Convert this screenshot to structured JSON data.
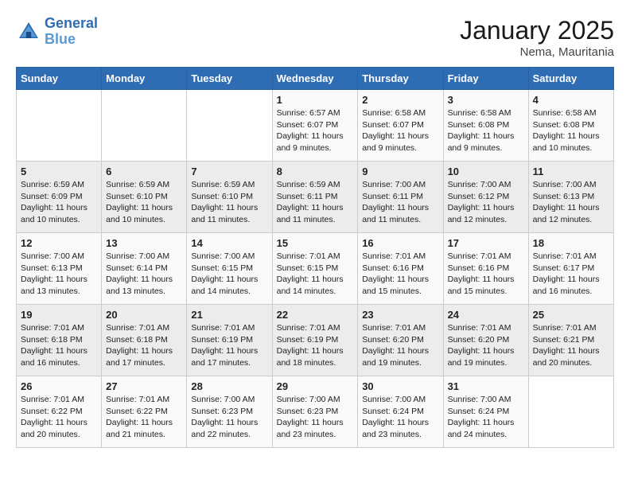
{
  "header": {
    "logo_line1": "General",
    "logo_line2": "Blue",
    "month": "January 2025",
    "location": "Nema, Mauritania"
  },
  "weekdays": [
    "Sunday",
    "Monday",
    "Tuesday",
    "Wednesday",
    "Thursday",
    "Friday",
    "Saturday"
  ],
  "weeks": [
    [
      {
        "day": "",
        "info": ""
      },
      {
        "day": "",
        "info": ""
      },
      {
        "day": "",
        "info": ""
      },
      {
        "day": "1",
        "info": "Sunrise: 6:57 AM\nSunset: 6:07 PM\nDaylight: 11 hours and 9 minutes."
      },
      {
        "day": "2",
        "info": "Sunrise: 6:58 AM\nSunset: 6:07 PM\nDaylight: 11 hours and 9 minutes."
      },
      {
        "day": "3",
        "info": "Sunrise: 6:58 AM\nSunset: 6:08 PM\nDaylight: 11 hours and 9 minutes."
      },
      {
        "day": "4",
        "info": "Sunrise: 6:58 AM\nSunset: 6:08 PM\nDaylight: 11 hours and 10 minutes."
      }
    ],
    [
      {
        "day": "5",
        "info": "Sunrise: 6:59 AM\nSunset: 6:09 PM\nDaylight: 11 hours and 10 minutes."
      },
      {
        "day": "6",
        "info": "Sunrise: 6:59 AM\nSunset: 6:10 PM\nDaylight: 11 hours and 10 minutes."
      },
      {
        "day": "7",
        "info": "Sunrise: 6:59 AM\nSunset: 6:10 PM\nDaylight: 11 hours and 11 minutes."
      },
      {
        "day": "8",
        "info": "Sunrise: 6:59 AM\nSunset: 6:11 PM\nDaylight: 11 hours and 11 minutes."
      },
      {
        "day": "9",
        "info": "Sunrise: 7:00 AM\nSunset: 6:11 PM\nDaylight: 11 hours and 11 minutes."
      },
      {
        "day": "10",
        "info": "Sunrise: 7:00 AM\nSunset: 6:12 PM\nDaylight: 11 hours and 12 minutes."
      },
      {
        "day": "11",
        "info": "Sunrise: 7:00 AM\nSunset: 6:13 PM\nDaylight: 11 hours and 12 minutes."
      }
    ],
    [
      {
        "day": "12",
        "info": "Sunrise: 7:00 AM\nSunset: 6:13 PM\nDaylight: 11 hours and 13 minutes."
      },
      {
        "day": "13",
        "info": "Sunrise: 7:00 AM\nSunset: 6:14 PM\nDaylight: 11 hours and 13 minutes."
      },
      {
        "day": "14",
        "info": "Sunrise: 7:00 AM\nSunset: 6:15 PM\nDaylight: 11 hours and 14 minutes."
      },
      {
        "day": "15",
        "info": "Sunrise: 7:01 AM\nSunset: 6:15 PM\nDaylight: 11 hours and 14 minutes."
      },
      {
        "day": "16",
        "info": "Sunrise: 7:01 AM\nSunset: 6:16 PM\nDaylight: 11 hours and 15 minutes."
      },
      {
        "day": "17",
        "info": "Sunrise: 7:01 AM\nSunset: 6:16 PM\nDaylight: 11 hours and 15 minutes."
      },
      {
        "day": "18",
        "info": "Sunrise: 7:01 AM\nSunset: 6:17 PM\nDaylight: 11 hours and 16 minutes."
      }
    ],
    [
      {
        "day": "19",
        "info": "Sunrise: 7:01 AM\nSunset: 6:18 PM\nDaylight: 11 hours and 16 minutes."
      },
      {
        "day": "20",
        "info": "Sunrise: 7:01 AM\nSunset: 6:18 PM\nDaylight: 11 hours and 17 minutes."
      },
      {
        "day": "21",
        "info": "Sunrise: 7:01 AM\nSunset: 6:19 PM\nDaylight: 11 hours and 17 minutes."
      },
      {
        "day": "22",
        "info": "Sunrise: 7:01 AM\nSunset: 6:19 PM\nDaylight: 11 hours and 18 minutes."
      },
      {
        "day": "23",
        "info": "Sunrise: 7:01 AM\nSunset: 6:20 PM\nDaylight: 11 hours and 19 minutes."
      },
      {
        "day": "24",
        "info": "Sunrise: 7:01 AM\nSunset: 6:20 PM\nDaylight: 11 hours and 19 minutes."
      },
      {
        "day": "25",
        "info": "Sunrise: 7:01 AM\nSunset: 6:21 PM\nDaylight: 11 hours and 20 minutes."
      }
    ],
    [
      {
        "day": "26",
        "info": "Sunrise: 7:01 AM\nSunset: 6:22 PM\nDaylight: 11 hours and 20 minutes."
      },
      {
        "day": "27",
        "info": "Sunrise: 7:01 AM\nSunset: 6:22 PM\nDaylight: 11 hours and 21 minutes."
      },
      {
        "day": "28",
        "info": "Sunrise: 7:00 AM\nSunset: 6:23 PM\nDaylight: 11 hours and 22 minutes."
      },
      {
        "day": "29",
        "info": "Sunrise: 7:00 AM\nSunset: 6:23 PM\nDaylight: 11 hours and 23 minutes."
      },
      {
        "day": "30",
        "info": "Sunrise: 7:00 AM\nSunset: 6:24 PM\nDaylight: 11 hours and 23 minutes."
      },
      {
        "day": "31",
        "info": "Sunrise: 7:00 AM\nSunset: 6:24 PM\nDaylight: 11 hours and 24 minutes."
      },
      {
        "day": "",
        "info": ""
      }
    ]
  ]
}
